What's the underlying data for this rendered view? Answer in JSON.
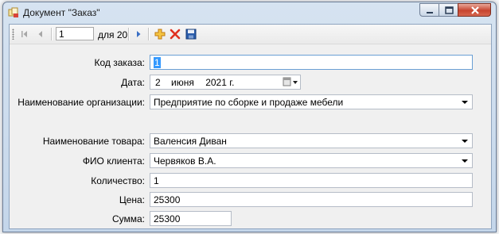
{
  "window": {
    "title": "Документ \"Заказ\""
  },
  "navigator": {
    "position": "1",
    "count_label": "для 20"
  },
  "form": {
    "order_code": {
      "label": "Код заказа:",
      "value": "1"
    },
    "date": {
      "label": "Дата:",
      "day": "2",
      "month": "июня",
      "year": "2021 г."
    },
    "organization": {
      "label": "Наименование организации:",
      "value": "Предприятие по сборке и продаже мебели"
    },
    "product": {
      "label": "Наименование товара:",
      "value": "Валенсия Диван"
    },
    "client": {
      "label": "ФИО клиента:",
      "value": "Червяков В.А."
    },
    "quantity": {
      "label": "Количество:",
      "value": "1"
    },
    "price": {
      "label": "Цена:",
      "value": "25300"
    },
    "total": {
      "label": "Сумма:",
      "value": "25300"
    }
  },
  "icons": {
    "app": "document-icon",
    "first": "move-first-icon",
    "prev": "move-previous-icon",
    "next": "move-next-icon",
    "add": "add-new-icon",
    "delete": "delete-icon",
    "save": "save-icon"
  },
  "colors": {
    "titlebar": "#c4d6ea",
    "close_button": "#c7442f",
    "selection": "#3399ff",
    "add_icon": "#e8a317",
    "delete_icon": "#e03020",
    "save_icon": "#2a5caa",
    "nav_icon": "#3a6fc4"
  }
}
